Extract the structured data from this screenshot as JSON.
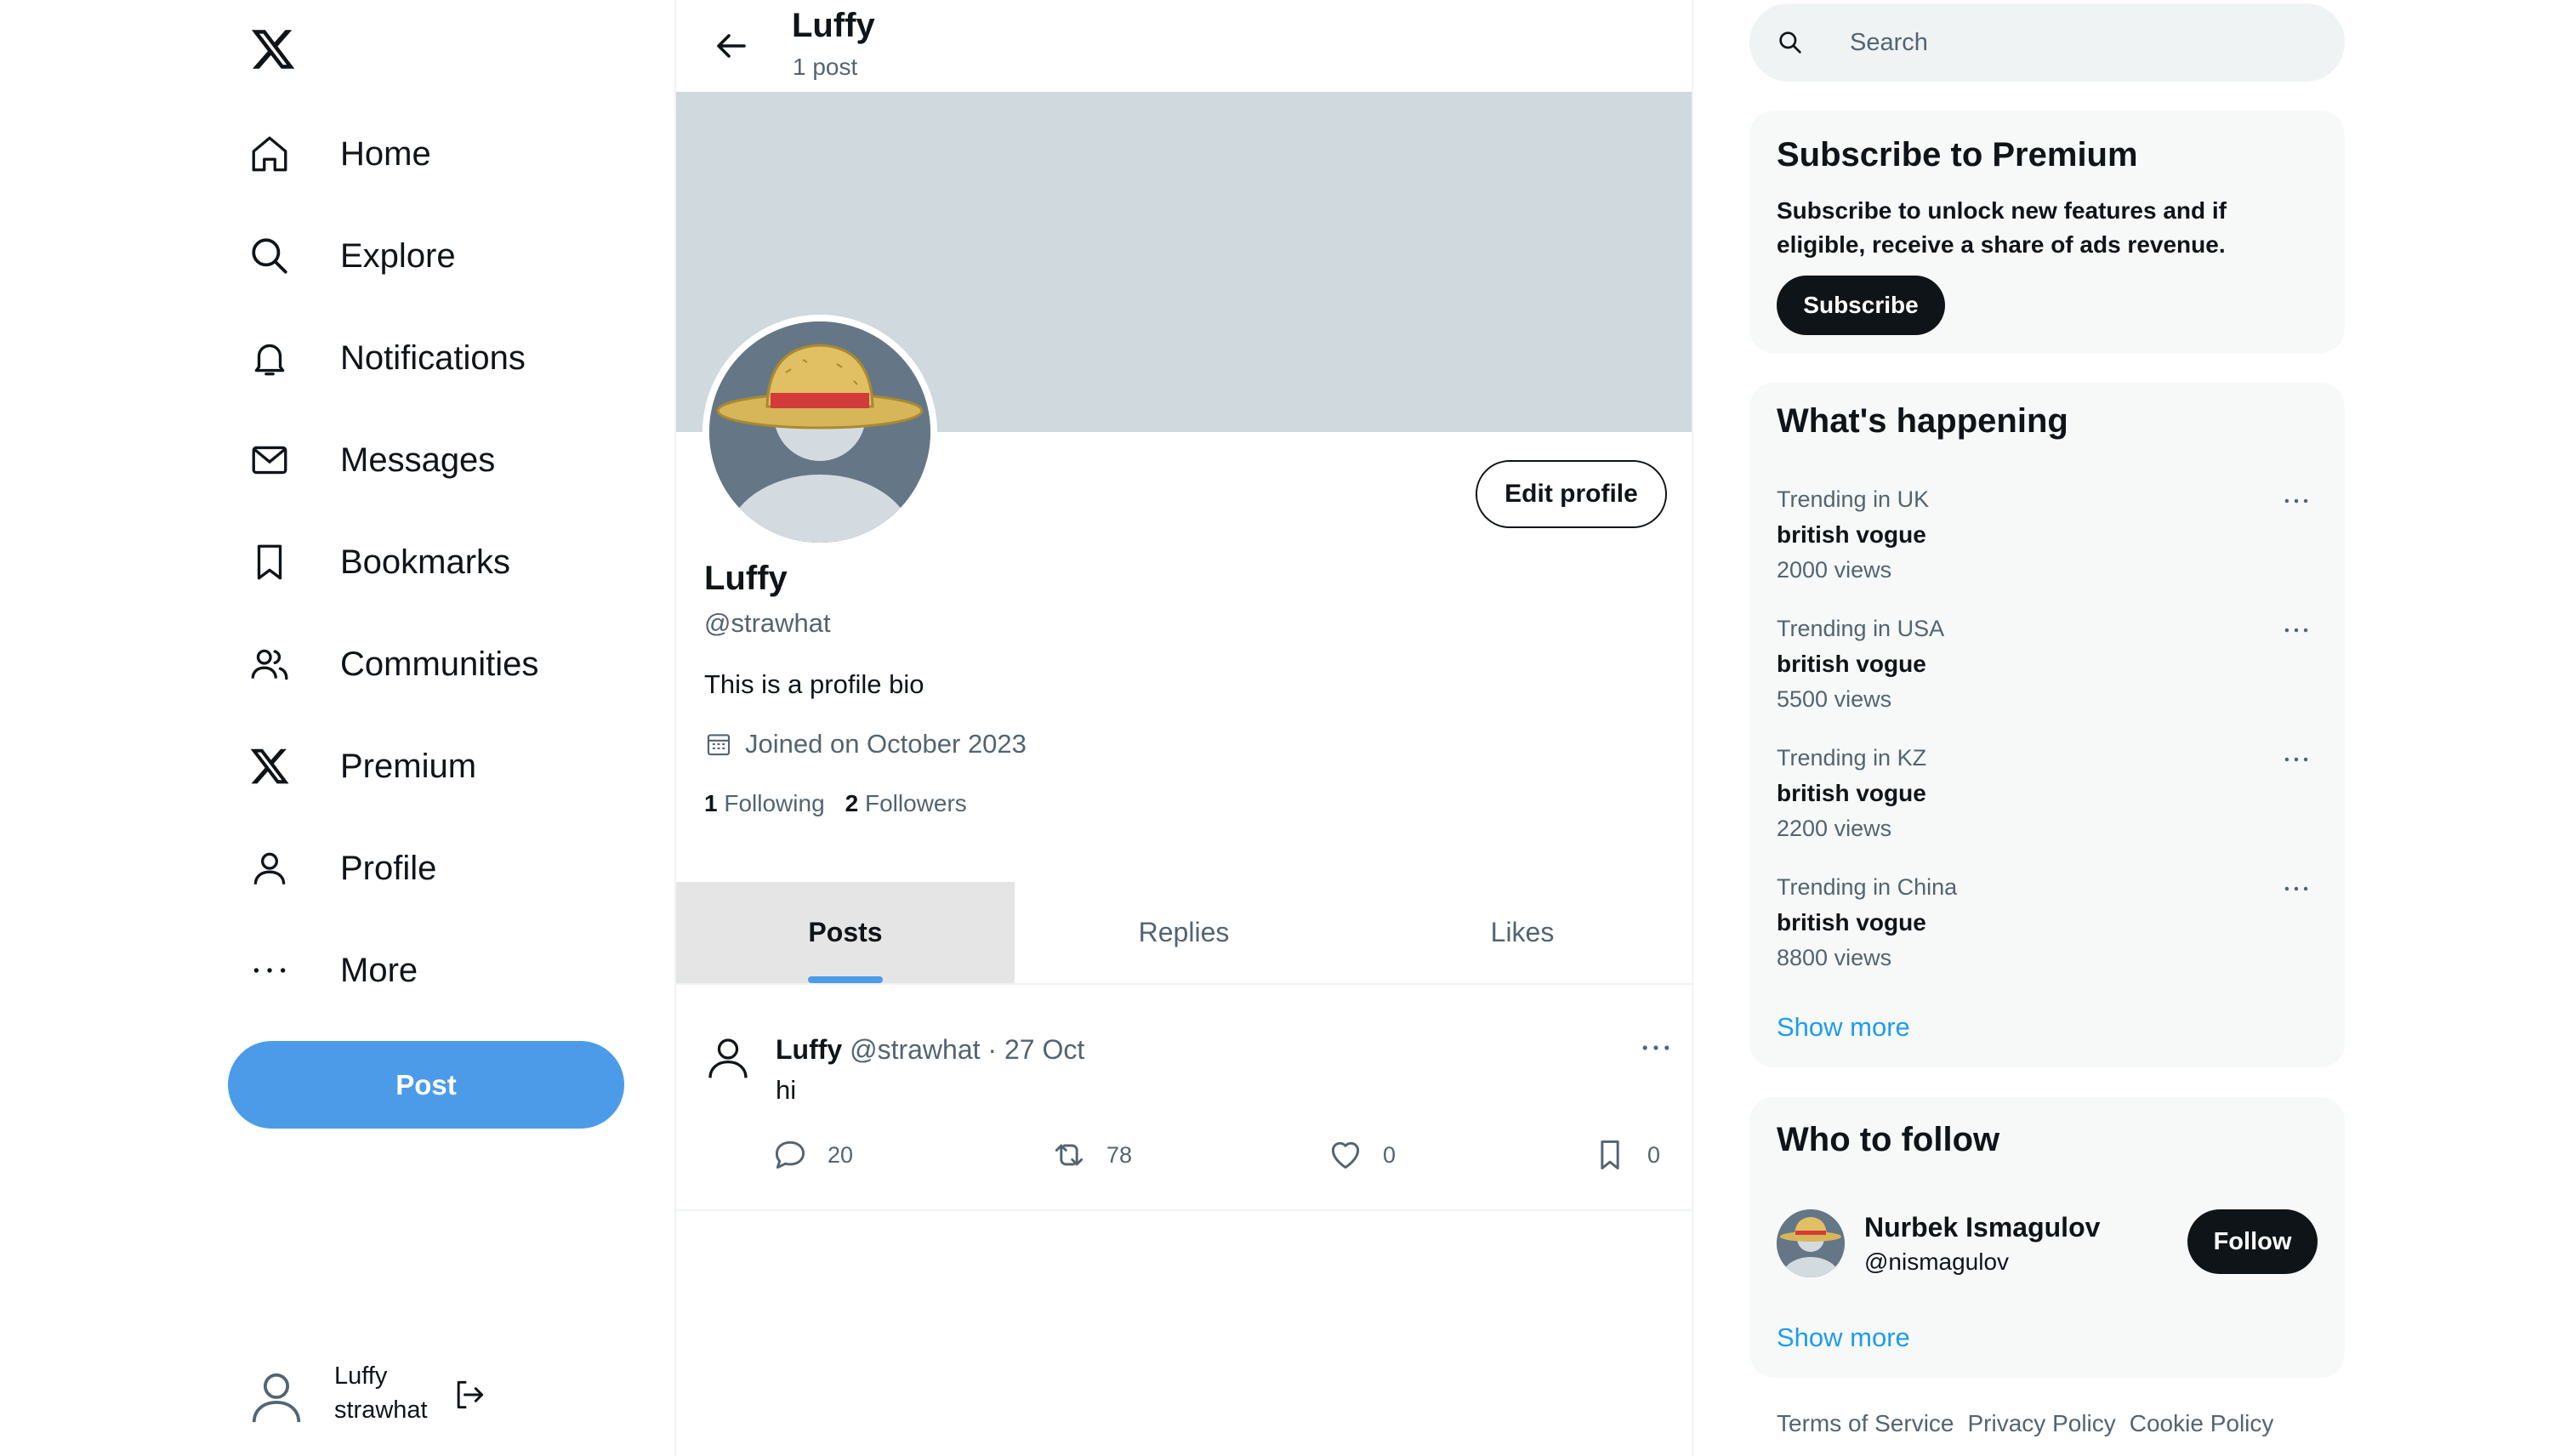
{
  "sidebar": {
    "logo_icon": "x-logo-icon",
    "items": [
      {
        "label": "Home",
        "icon": "home-icon"
      },
      {
        "label": "Explore",
        "icon": "search-icon"
      },
      {
        "label": "Notifications",
        "icon": "bell-icon"
      },
      {
        "label": "Messages",
        "icon": "mail-icon"
      },
      {
        "label": "Bookmarks",
        "icon": "bookmark-icon"
      },
      {
        "label": "Communities",
        "icon": "people-icon"
      },
      {
        "label": "Premium",
        "icon": "x-logo-icon"
      },
      {
        "label": "Profile",
        "icon": "person-icon"
      },
      {
        "label": "More",
        "icon": "more-horizontal-icon"
      }
    ],
    "post_label": "Post",
    "account": {
      "name": "Luffy",
      "handle": "strawhat"
    }
  },
  "header": {
    "name": "Luffy",
    "post_count": "1 post"
  },
  "profile": {
    "edit_label": "Edit profile",
    "name": "Luffy",
    "handle": "@strawhat",
    "bio": "This is a profile bio",
    "joined": "Joined on October 2023",
    "following_count": "1",
    "following_label": "Following",
    "followers_count": "2",
    "followers_label": "Followers"
  },
  "tabs": [
    {
      "label": "Posts",
      "active": true
    },
    {
      "label": "Replies",
      "active": false
    },
    {
      "label": "Likes",
      "active": false
    }
  ],
  "post": {
    "author": "Luffy",
    "meta": "@strawhat · 27 Oct",
    "text": "hi",
    "replies": "20",
    "reposts": "78",
    "likes": "0",
    "bookmarks": "0"
  },
  "search": {
    "placeholder": "Search"
  },
  "premium": {
    "title": "Subscribe to Premium",
    "text": "Subscribe to unlock new features and if eligible, receive a share of ads revenue.",
    "button": "Subscribe"
  },
  "trends": {
    "title": "What's happening",
    "items": [
      {
        "context": "Trending in UK",
        "topic": "british vogue",
        "views": "2000 views"
      },
      {
        "context": "Trending in USA",
        "topic": "british vogue",
        "views": "5500 views"
      },
      {
        "context": "Trending in KZ",
        "topic": "british vogue",
        "views": "2200 views"
      },
      {
        "context": "Trending in China",
        "topic": "british vogue",
        "views": "8800 views"
      }
    ],
    "show_more": "Show more"
  },
  "who_to_follow": {
    "title": "Who to follow",
    "name": "Nurbek Ismagulov",
    "handle": "@nismagulov",
    "button": "Follow",
    "show_more": "Show more"
  },
  "footer": {
    "links": [
      "Terms of Service",
      "Privacy Policy",
      "Cookie Policy"
    ]
  },
  "colors": {
    "accent": "#4c9be8",
    "link": "#1d9bf0",
    "banner": "#cfd9de",
    "dark_button": "#0f1419"
  }
}
